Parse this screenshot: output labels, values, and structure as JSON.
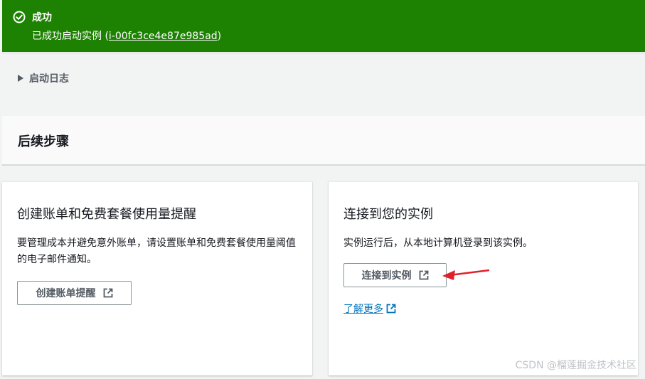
{
  "flash": {
    "title": "成功",
    "message_prefix": "已成功启动实例 (",
    "instance_id": "i-00fc3ce4e87e985ad",
    "message_suffix": ")"
  },
  "launch_log": {
    "label": "启动日志"
  },
  "next_steps": {
    "title": "后续步骤"
  },
  "billing_card": {
    "title": "创建账单和免费套餐使用量提醒",
    "description": "要管理成本并避免意外账单，请设置账单和免费套餐使用量阈值的电子邮件通知。",
    "button_label": "创建账单提醒"
  },
  "connect_card": {
    "title": "连接到您的实例",
    "description": "实例运行后，从本地计算机登录到该实例。",
    "button_label": "连接到实例",
    "learn_more": "了解更多"
  },
  "watermark": "CSDN @榴莲掘金技术社区",
  "colors": {
    "success": "#1d8102",
    "link": "#0073bb",
    "annotation_arrow": "#e0202a"
  },
  "icons": {
    "success": "check-circle-icon",
    "expand": "caret-right-icon",
    "external": "external-link-icon"
  }
}
